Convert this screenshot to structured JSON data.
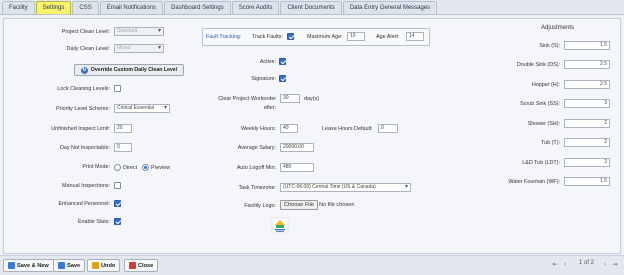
{
  "tabs": [
    "Facility",
    "Settings",
    "CSS",
    "Email Notifications",
    "Dashboard Settings",
    "Score Audits",
    "Client Documents",
    "Data Entry General Messages"
  ],
  "left": {
    "project_clean_level": {
      "label": "Project Clean Level:",
      "value": "Standard"
    },
    "daily_clean_level": {
      "label": "Daily Clean Level:",
      "value": "Mixed"
    },
    "override_button": "Override Custom Daily Clean Level",
    "lock_cleaning_levels": {
      "label": "Lock Cleaning Levels:",
      "checked": false
    },
    "priority_level_scheme": {
      "label": "Priority Level Scheme:",
      "value": "Critical Essential"
    },
    "unfinished_inspect_limit": {
      "label": "Unfinished Inspect Limit:",
      "value": "20"
    },
    "day_not_inspectable": {
      "label": "Day Not Inspectable:",
      "value": "0"
    },
    "print_mode": {
      "label": "Print Mode:",
      "options": [
        "Direct",
        "Preview"
      ],
      "selected": "Preview"
    },
    "manual_inspections": {
      "label": "Manual Inspections:",
      "checked": false
    },
    "enhanced_personnel": {
      "label": "Enhanced Personnel:",
      "checked": true
    },
    "enable_stats": {
      "label": "Enable Stats:",
      "checked": true
    }
  },
  "fault_tracking": {
    "title": "Fault Tracking:",
    "track_faults": {
      "label": "Track Faults:",
      "checked": true
    },
    "maximum_age": {
      "label": "Maximum Age:",
      "value": "10"
    },
    "age_alert": {
      "label": "Age Alert:",
      "value": "14"
    }
  },
  "middle": {
    "active": {
      "label": "Active:",
      "checked": true
    },
    "signature": {
      "label": "Signature:",
      "checked": true
    },
    "clear_workorder": {
      "label_line1": "Clear Project Workorder",
      "label_line2": "after:",
      "value": "30",
      "unit": "day(s)"
    },
    "weekly_hours": {
      "label": "Weekly Hours:",
      "value": "40"
    },
    "leave_hours_default": {
      "label": "Leave Hours Default:",
      "value": "0"
    },
    "average_salary": {
      "label": "Average Salary:",
      "value": "20000.00"
    },
    "auto_logoff_min": {
      "label": "Auto Logoff Min:",
      "value": "480"
    },
    "task_timezone": {
      "label": "Task Timezone:",
      "value": "(UTC-06:00) Central Time (US & Canada)"
    },
    "facility_logo": {
      "label": "Facility Logo:",
      "button": "Choose File",
      "status": "No file chosen"
    }
  },
  "adjustments": {
    "title": "Adjustments",
    "items": [
      {
        "label": "Sink (S):",
        "value": "1.5"
      },
      {
        "label": "Double Sink (DS):",
        "value": "2.5"
      },
      {
        "label": "Hopper (H):",
        "value": "2.5"
      },
      {
        "label": "Scrub Sink (SS):",
        "value": "3"
      },
      {
        "label": "Shower (SH):",
        "value": "2"
      },
      {
        "label": "Tub (T):",
        "value": "2"
      },
      {
        "label": "L&D Tub (LDT):",
        "value": "3"
      },
      {
        "label": "Water Fountain (WF):",
        "value": "1.5"
      }
    ]
  },
  "toolbar": {
    "save_new": "Save & New",
    "save": "Save",
    "undo": "Undo",
    "close": "Close"
  },
  "pager": {
    "text": "1 of 2"
  },
  "colors": {
    "active_tab": "#f7f36c",
    "checkbox_on": "#2f6dc9"
  }
}
